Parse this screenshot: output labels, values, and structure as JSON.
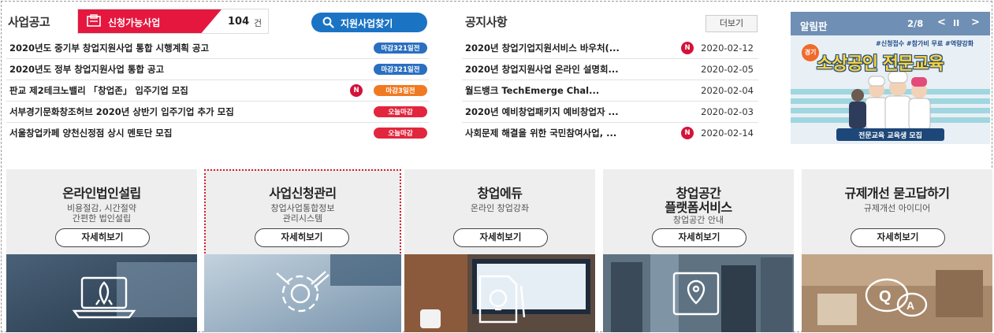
{
  "business": {
    "title": "사업공고",
    "apply_label": "신청가능사업",
    "apply_count": "104",
    "apply_unit": "건",
    "find_label": "지원사업찾기",
    "items": [
      {
        "title": "2020년도 중기부 창업지원사업 통합 시행계획 공고",
        "new": "",
        "badge": "마감321일전",
        "badge_color": "blue"
      },
      {
        "title": "2020년도 정부 창업지원사업 통합 공고",
        "new": "",
        "badge": "마감321일전",
        "badge_color": "blue"
      },
      {
        "title": "판교 제2테크노밸리 「창업존」 입주기업 모집",
        "new": "N",
        "badge": "마감3일전",
        "badge_color": "orange"
      },
      {
        "title": "서부경기문화창조허브 2020년 상반기 입주기업 추가 모집",
        "new": "",
        "badge": "오늘마감",
        "badge_color": "red"
      },
      {
        "title": "서울창업카페 양천신정점 상시 멘토단 모집",
        "new": "",
        "badge": "오늘마감",
        "badge_color": "red"
      }
    ]
  },
  "notice": {
    "title": "공지사항",
    "more_label": "더보기",
    "items": [
      {
        "title": "2020년 창업기업지원서비스 바우처(...",
        "new": "N",
        "date": "2020-02-12"
      },
      {
        "title": "2020년 창업지원사업 온라인 설명회...",
        "new": "",
        "date": "2020-02-05"
      },
      {
        "title": "월드뱅크 TechEmerge Chal...",
        "new": "",
        "date": "2020-02-04"
      },
      {
        "title": "2020년 예비창업패키지 예비창업자 ...",
        "new": "",
        "date": "2020-02-03"
      },
      {
        "title": "사회문제 해결을 위한 국민참여사업, ...",
        "new": "N",
        "date": "2020-02-14"
      }
    ]
  },
  "board": {
    "title": "알림판",
    "page": "2/8",
    "prev": "<",
    "pause": "II",
    "next": ">",
    "banner": {
      "hashtags": "#신청접수  #참가비 무료  #역량강화",
      "tag": "경기",
      "headline": "소상공인 전문교육",
      "caption": "전문교육 교육생 모집"
    }
  },
  "cards": [
    {
      "title": "온라인법인설립",
      "desc1": "비용절감, 시간절약",
      "desc2": "간편한 법인설립",
      "button": "자세히보기",
      "icon": "laptop-rocket-icon"
    },
    {
      "title": "사업신청관리",
      "desc1": "창업사업통합정보",
      "desc2": "관리시스템",
      "button": "자세히보기",
      "icon": "gear-pencil-icon"
    },
    {
      "title": "창업에듀",
      "desc1": "온라인 창업강좌",
      "desc2": "",
      "button": "자세히보기",
      "icon": "document-lightbulb-icon"
    },
    {
      "title": "창업공간",
      "title2": "플랫폼서비스",
      "desc1": "창업공간 안내",
      "desc2": "",
      "button": "자세히보기",
      "icon": "map-pin-icon"
    },
    {
      "title": "규제개선 묻고답하기",
      "desc1": "규제개선 아이디어",
      "desc2": "",
      "button": "자세히보기",
      "icon": "qa-bubble-icon"
    }
  ],
  "colors": {
    "accent_red": "#e5173f",
    "accent_blue": "#1b73c4",
    "board_header": "#6f8fb4"
  }
}
